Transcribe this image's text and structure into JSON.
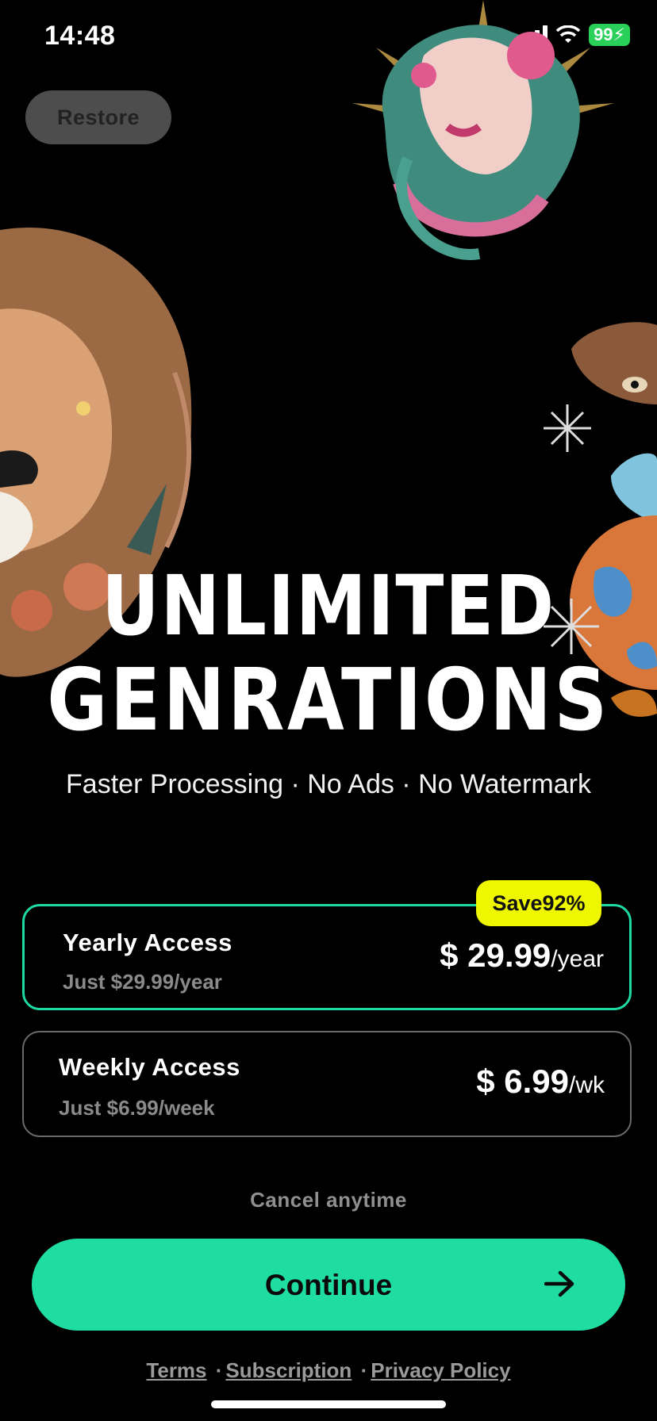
{
  "status_bar": {
    "time": "14:48",
    "battery": "99"
  },
  "header": {
    "restore_label": "Restore"
  },
  "hero": {
    "headline_line1": "UNLIMITED",
    "headline_line2": "GENRATIONS",
    "subtitle": "Faster Processing · No Ads · No Watermark"
  },
  "plans": [
    {
      "title": "Yearly Access",
      "subtitle": "Just $29.99/year",
      "price": "$ 29.99",
      "unit": "/year",
      "badge": "Save92%",
      "selected": true
    },
    {
      "title": "Weekly Access",
      "subtitle": "Just $6.99/week",
      "price": "$ 6.99",
      "unit": "/wk",
      "selected": false
    }
  ],
  "cancel_text": "Cancel anytime",
  "cta": {
    "label": "Continue"
  },
  "footer": {
    "terms": "Terms",
    "separator": "·",
    "subscription": "Subscription",
    "privacy": "Privacy Policy"
  },
  "colors": {
    "accent": "#1fdca0",
    "badge": "#eef600",
    "background": "#000000"
  },
  "icons": [
    "signal-icon",
    "wifi-icon",
    "battery-icon",
    "arrow-right-icon",
    "medusa-illustration",
    "lion-illustration",
    "fish-illustration",
    "sparkle-icon"
  ]
}
